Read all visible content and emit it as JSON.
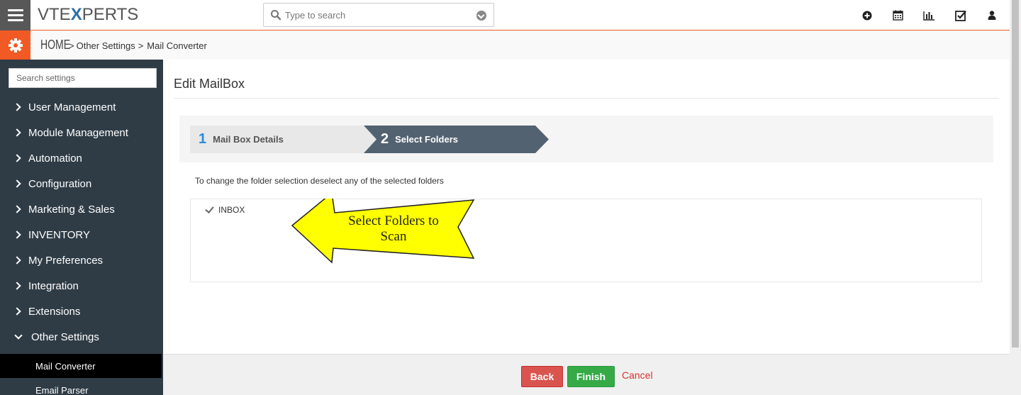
{
  "header": {
    "logo_pre": "VTE",
    "logo_x": "X",
    "logo_post": "PERTS",
    "search_placeholder": "Type to search",
    "icons": [
      "plus-circle-icon",
      "calendar-icon",
      "bar-chart-icon",
      "checkbox-icon",
      "user-icon"
    ]
  },
  "breadcrumb": {
    "home": "HOME",
    "sep": ">",
    "items": [
      "Other Settings",
      "Mail Converter"
    ]
  },
  "sidebar": {
    "search_placeholder": "Search settings",
    "items": [
      {
        "label": "User Management"
      },
      {
        "label": "Module Management"
      },
      {
        "label": "Automation"
      },
      {
        "label": "Configuration"
      },
      {
        "label": "Marketing & Sales"
      },
      {
        "label": "INVENTORY"
      },
      {
        "label": "My Preferences"
      },
      {
        "label": "Integration"
      },
      {
        "label": "Extensions"
      },
      {
        "label": "Other Settings"
      }
    ],
    "subitems": [
      {
        "label": "Mail Converter",
        "active": true
      },
      {
        "label": "Email Parser",
        "active": false
      }
    ]
  },
  "main": {
    "title": "Edit MailBox",
    "steps": [
      {
        "num": "1",
        "label": "Mail Box Details"
      },
      {
        "num": "2",
        "label": "Select Folders"
      }
    ],
    "instruction": "To change the folder selection deselect any of the selected folders",
    "folders": [
      {
        "label": "INBOX",
        "checked": true
      }
    ],
    "callout": {
      "line1": "Select Folders to",
      "line2": "Scan"
    }
  },
  "footer": {
    "back": "Back",
    "finish": "Finish",
    "cancel": "Cancel"
  },
  "colors": {
    "accent": "#f15a24",
    "sidebar": "#2f3c46",
    "step_active": "#536270",
    "back": "#d9534f",
    "finish": "#35aa47",
    "callout": "#ffff00"
  }
}
